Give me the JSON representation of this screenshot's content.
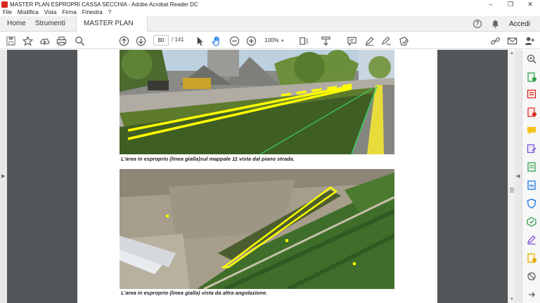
{
  "window": {
    "title": "MASTER PLAN ESPROPRI CASSA SECCHIA - Adobe Acrobat Reader DC",
    "controls": [
      "–",
      "❐",
      "✕"
    ]
  },
  "menu": [
    "File",
    "Modifica",
    "Vista",
    "Firma",
    "Finestra",
    "?"
  ],
  "tabs": {
    "home": "Home",
    "tools": "Strumenti",
    "document": "MASTER PLAN ESP...",
    "close": "×"
  },
  "header_right": {
    "help": "?",
    "signin": "Accedi"
  },
  "toolbar": {
    "page_current": "80",
    "page_total": "/ 141",
    "zoom": "100%"
  },
  "document": {
    "caption_1": "L'area in esproprio (linea gialla)sul mappale 11  vista dal piano strada.",
    "caption_2": "L'area in esproprio (linea gialla) vista da altra angolazione."
  },
  "colors": {
    "accent": "#1473e6",
    "highlight_yellow": "#ffff00",
    "acrobat_red": "#d6281e",
    "doc_background": "#525659"
  }
}
